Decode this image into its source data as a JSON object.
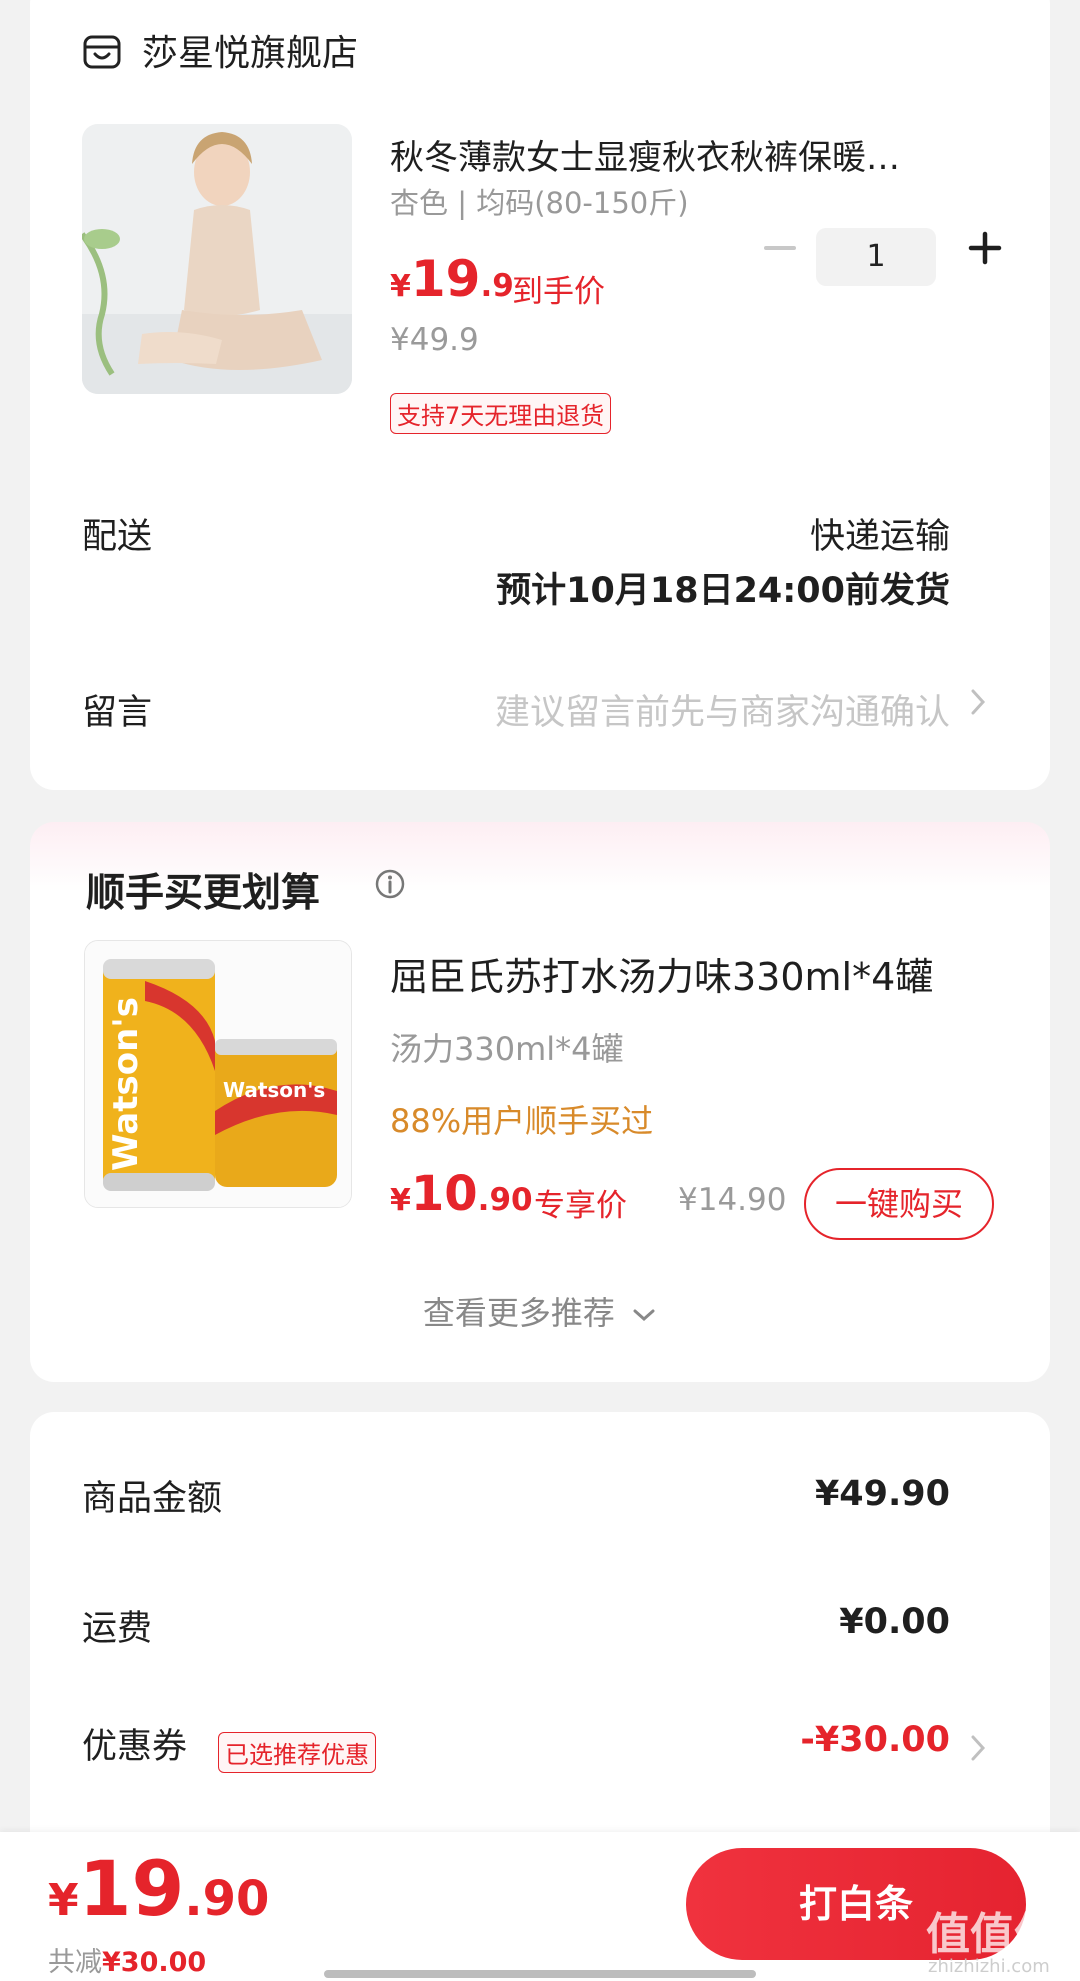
{
  "store": {
    "name": "莎星悦旗舰店"
  },
  "product": {
    "title": "秋冬薄款女士显瘦秋衣秋裤保暖…",
    "spec": "杏色 | 均码(80-150斤)",
    "price_yen": "¥",
    "price_int": "19",
    "price_dec": ".9",
    "price_tag": "到手价",
    "original_price": "¥49.9",
    "return_policy": "支持7天无理由退货",
    "quantity": "1"
  },
  "shipping": {
    "label": "配送",
    "method": "快递运输",
    "eta": "预计10月18日24:00前发货"
  },
  "message": {
    "label": "留言",
    "placeholder": "建议留言前先与商家沟通确认"
  },
  "recommend": {
    "title": "顺手买更划算",
    "item": {
      "title": "屈臣氏苏打水汤力味330ml*4罐",
      "spec": "汤力330ml*4罐",
      "bought": "88%用户顺手买过",
      "price_yen": "¥",
      "price_int": "10",
      "price_dec": ".90",
      "price_tag": "专享价",
      "original_price": "¥14.90",
      "buy_label": "一键购买",
      "brand": "Watson's"
    },
    "more_label": "查看更多推荐"
  },
  "summary": {
    "goods_label": "商品金额",
    "goods_value": "¥49.90",
    "freight_label": "运费",
    "freight_value": "¥0.00",
    "coupon_label": "优惠券",
    "coupon_badge": "已选推荐优惠",
    "coupon_value": "-¥30.00"
  },
  "bottom": {
    "total_yen": "¥",
    "total_int": "19",
    "total_dec": ".90",
    "saved_prefix": "共减",
    "saved_amount": "¥30.00",
    "pay_label": "打白条",
    "watermark": "值值值",
    "watermark_sub": "zhizhizhi.com"
  },
  "colors": {
    "accent": "#e5242b",
    "bought_orange": "#d88a2a",
    "background": "#f2f2f2"
  }
}
